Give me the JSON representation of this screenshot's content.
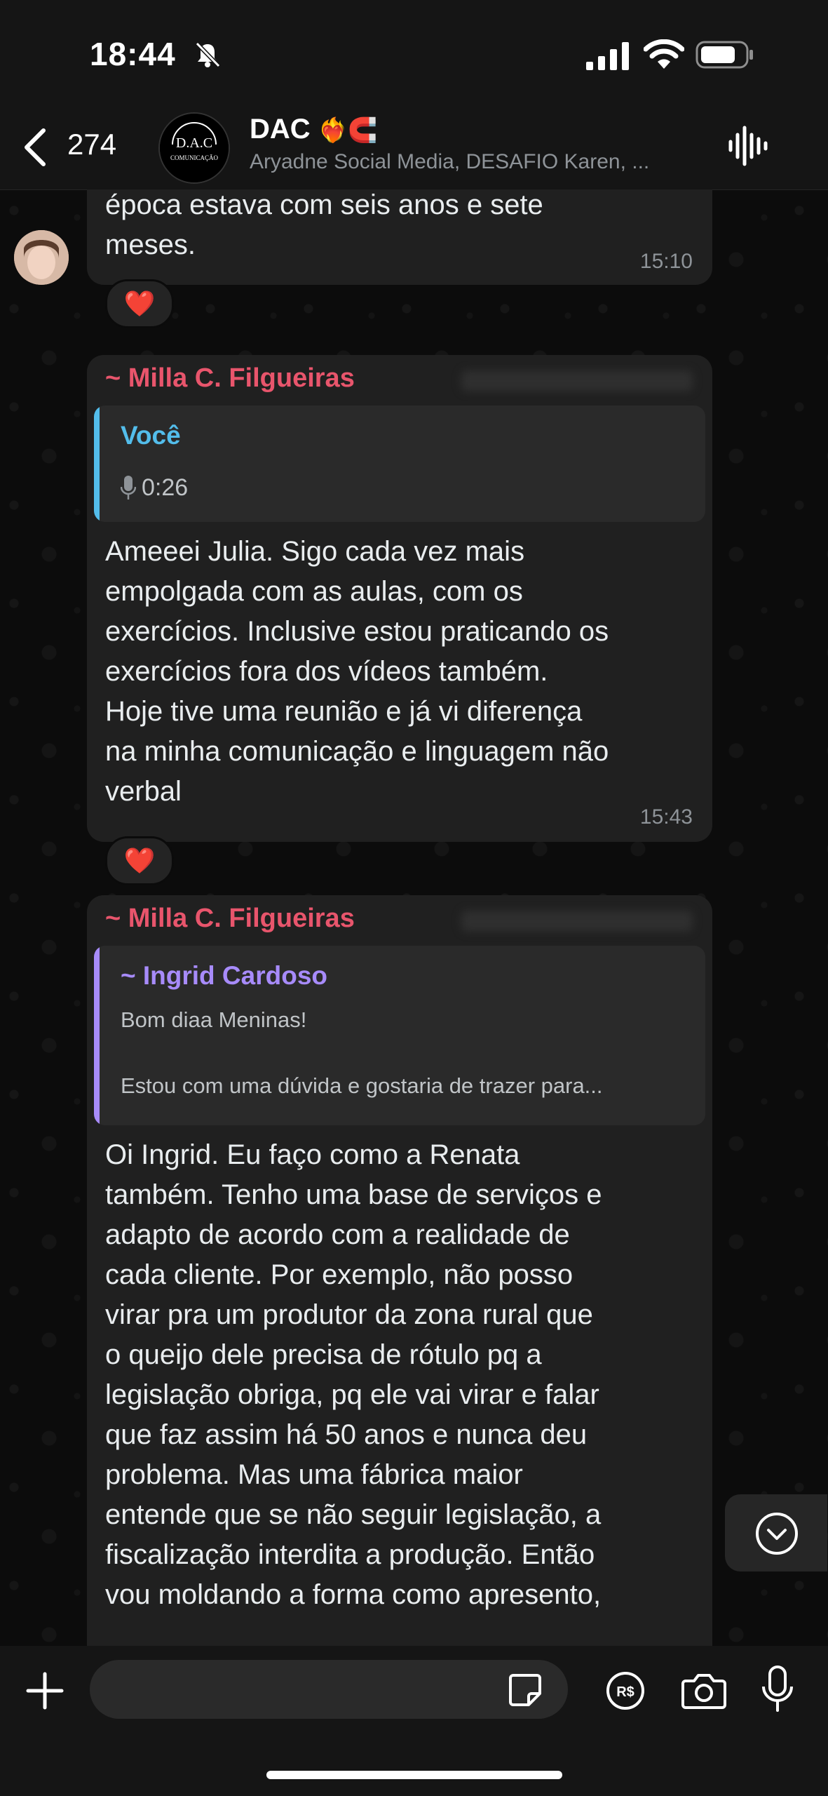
{
  "status_bar": {
    "time": "18:44"
  },
  "header": {
    "back_count": "274",
    "group_name": "DAC",
    "group_emoji": "❤️‍🔥🧲",
    "participants": "Aryadne Social Media, DESAFIO Karen, ..."
  },
  "messages": [
    {
      "text": "época estava com seis anos e sete\nmeses.",
      "time": "15:10",
      "reaction": "❤️"
    },
    {
      "sender": "~ Milla C. Filgueiras",
      "quote": {
        "name": "Você",
        "voice_duration": "0:26"
      },
      "text": "Ameeei Julia. Sigo cada vez mais\nempolgada com as aulas, com os\nexercícios. Inclusive estou praticando os\nexercícios fora dos vídeos também.\nHoje tive uma reunião e já vi diferença\nna minha comunicação e linguagem não\nverbal",
      "time": "15:43",
      "reaction": "❤️"
    },
    {
      "sender": "~ Milla C. Filgueiras",
      "quote": {
        "name": "~ Ingrid Cardoso",
        "line1": "Bom diaa Meninas!",
        "line2": "Estou com uma dúvida e gostaria de trazer para..."
      },
      "text": "Oi Ingrid. Eu faço como a Renata\ntambém. Tenho uma base de serviços e\nadapto de acordo com a realidade de\ncada cliente. Por exemplo, não posso\nvirar pra um produtor da zona rural que\no queijo dele precisa de rótulo pq a\nlegislação obriga, pq ele vai virar e falar\nque faz assim há 50 anos e nunca deu\nproblema. Mas uma fábrica maior\nentende que se não seguir legislação, a\nfiscalização interdita a produção. Então\nvou moldando a forma como apresento,"
    }
  ],
  "colors": {
    "sender_name": "#e8556c",
    "quote_you": "#53bdeb",
    "quote_ingrid": "#a78bfa",
    "bubble": "#202020"
  },
  "icons": [
    "bell-slash-icon",
    "signal-icon",
    "wifi-icon",
    "battery-icon",
    "back-chevron-icon",
    "audio-wave-icon",
    "mic-icon",
    "plus-icon",
    "sticker-icon",
    "payment-icon",
    "camera-icon",
    "chevron-down-icon"
  ]
}
